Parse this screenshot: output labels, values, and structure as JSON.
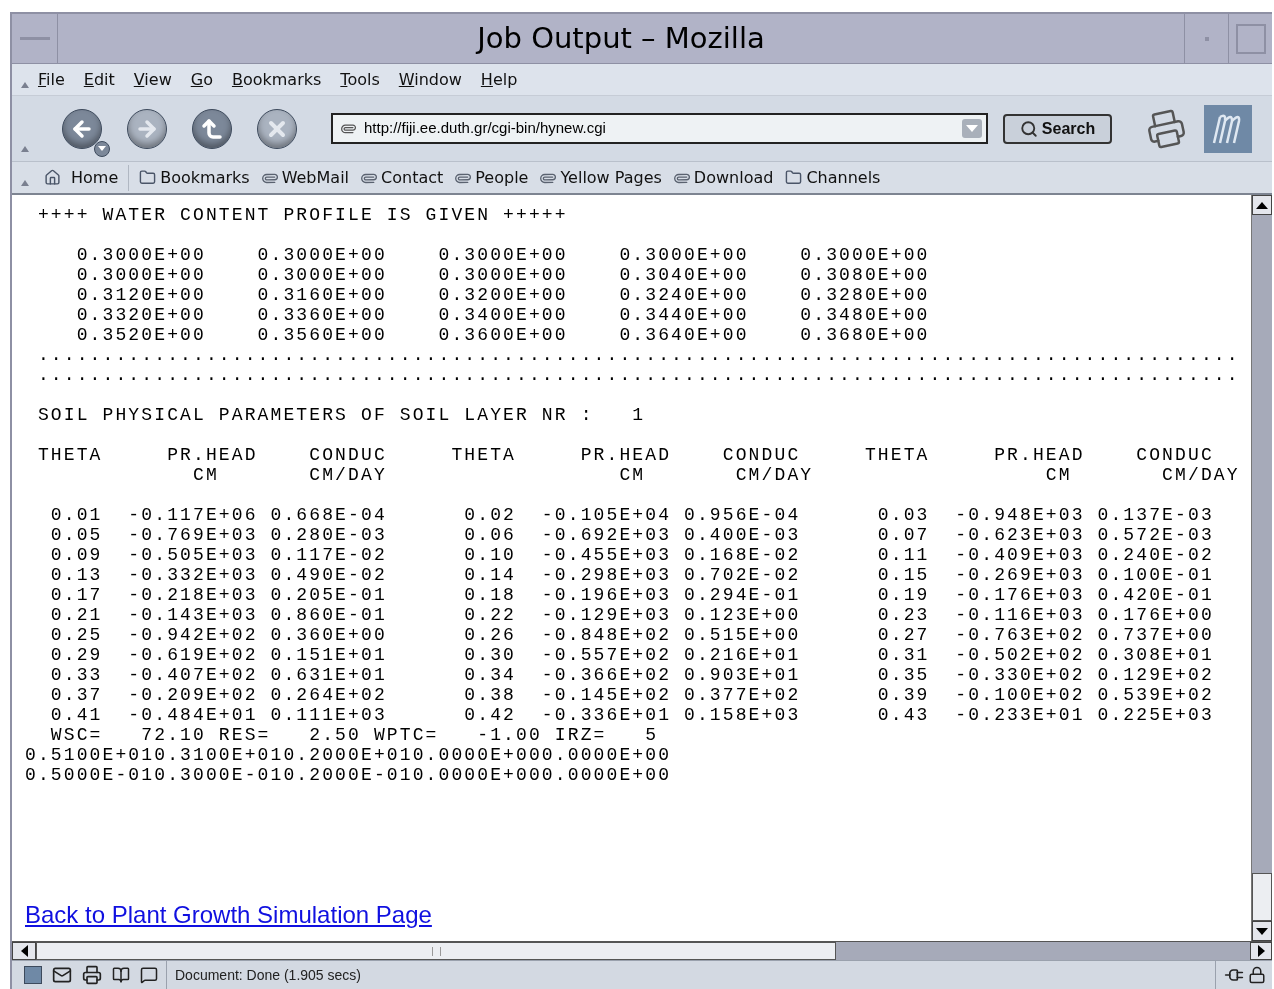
{
  "window": {
    "title": "Job Output – Mozilla"
  },
  "menu": [
    {
      "label": "File"
    },
    {
      "label": "Edit"
    },
    {
      "label": "View"
    },
    {
      "label": "Go"
    },
    {
      "label": "Bookmarks"
    },
    {
      "label": "Tools"
    },
    {
      "label": "Window"
    },
    {
      "label": "Help"
    }
  ],
  "address": {
    "value": "http://fiji.ee.duth.gr/cgi-bin/hynew.cgi"
  },
  "search_button": "Search",
  "bookmarks_bar": [
    {
      "label": "Home",
      "kind": "home"
    },
    {
      "label": "Bookmarks",
      "kind": "folder"
    },
    {
      "label": "WebMail",
      "kind": "link"
    },
    {
      "label": "Contact",
      "kind": "link"
    },
    {
      "label": "People",
      "kind": "link"
    },
    {
      "label": "Yellow Pages",
      "kind": "link"
    },
    {
      "label": "Download",
      "kind": "link"
    },
    {
      "label": "Channels",
      "kind": "folder"
    }
  ],
  "content": {
    "blocks": [
      [
        " ++++ WATER CONTENT PROFILE IS GIVEN +++++"
      ],
      [
        "    0.3000E+00    0.3000E+00    0.3000E+00    0.3000E+00    0.3000E+00",
        "    0.3000E+00    0.3000E+00    0.3000E+00    0.3040E+00    0.3080E+00",
        "    0.3120E+00    0.3160E+00    0.3200E+00    0.3240E+00    0.3280E+00",
        "    0.3320E+00    0.3360E+00    0.3400E+00    0.3440E+00    0.3480E+00",
        "    0.3520E+00    0.3560E+00    0.3600E+00    0.3640E+00    0.3680E+00",
        " .............................................................................................",
        " ............................................................................................."
      ],
      [
        " SOIL PHYSICAL PARAMETERS OF SOIL LAYER NR :   1"
      ],
      [
        " THETA     PR.HEAD    CONDUC     THETA     PR.HEAD    CONDUC     THETA     PR.HEAD    CONDUC",
        "             CM       CM/DAY                  CM       CM/DAY                  CM       CM/DAY"
      ],
      [
        "  0.01  -0.117E+06 0.668E-04      0.02  -0.105E+04 0.956E-04      0.03  -0.948E+03 0.137E-03",
        "  0.05  -0.769E+03 0.280E-03      0.06  -0.692E+03 0.400E-03      0.07  -0.623E+03 0.572E-03",
        "  0.09  -0.505E+03 0.117E-02      0.10  -0.455E+03 0.168E-02      0.11  -0.409E+03 0.240E-02",
        "  0.13  -0.332E+03 0.490E-02      0.14  -0.298E+03 0.702E-02      0.15  -0.269E+03 0.100E-01",
        "  0.17  -0.218E+03 0.205E-01      0.18  -0.196E+03 0.294E-01      0.19  -0.176E+03 0.420E-01",
        "  0.21  -0.143E+03 0.860E-01      0.22  -0.129E+03 0.123E+00      0.23  -0.116E+03 0.176E+00",
        "  0.25  -0.942E+02 0.360E+00      0.26  -0.848E+02 0.515E+00      0.27  -0.763E+02 0.737E+00",
        "  0.29  -0.619E+02 0.151E+01      0.30  -0.557E+02 0.216E+01      0.31  -0.502E+02 0.308E+01",
        "  0.33  -0.407E+02 0.631E+01      0.34  -0.366E+02 0.903E+01      0.35  -0.330E+02 0.129E+02",
        "  0.37  -0.209E+02 0.264E+02      0.38  -0.145E+02 0.377E+02      0.39  -0.100E+02 0.539E+02",
        "  0.41  -0.484E+01 0.111E+03      0.42  -0.336E+01 0.158E+03      0.43  -0.233E+01 0.225E+03",
        "  WSC=   72.10 RES=   2.50 WPTC=   -1.00 IRZ=   5",
        "0.5100E+010.3100E+010.2000E+010.0000E+000.0000E+00",
        "0.5000E-010.3000E-010.2000E-010.0000E+000.0000E+00"
      ]
    ],
    "link": "Back to Plant Growth Simulation Page"
  },
  "status_bar": {
    "text": "Document: Done (1.905 secs)"
  }
}
